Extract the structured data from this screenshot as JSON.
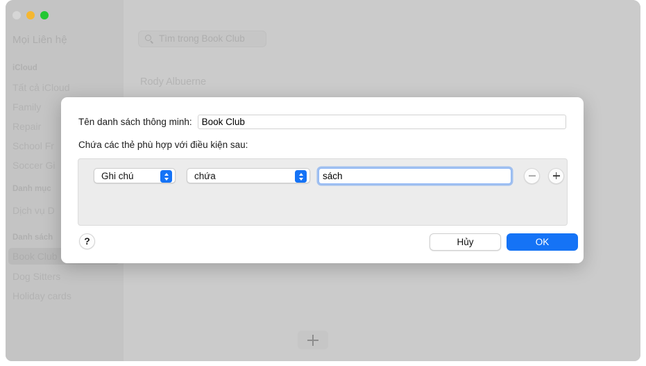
{
  "window": {
    "traffic_lights": [
      "close",
      "minimize",
      "maximize"
    ],
    "sidebar": {
      "title": "Mọi Liên hệ",
      "groups": [
        {
          "header": "iCloud",
          "items": [
            "Tất cả iCloud",
            "Family",
            "Repair",
            "School Fr",
            "Soccer Gi"
          ]
        },
        {
          "header": "Danh mục",
          "items": [
            "Dịch vụ D"
          ]
        },
        {
          "header": "Danh sách",
          "items": [
            "Book Club",
            "Dog Sitters",
            "Holiday cards"
          ]
        }
      ],
      "selected_item": "Book Club"
    },
    "list_column": {
      "search_placeholder": "Tìm trong Book Club",
      "search_icon": "search-icon",
      "contacts": [
        "Rody Albuerne"
      ]
    },
    "detail_pane": {
      "add_button_icon": "plus-icon"
    }
  },
  "dialog": {
    "name_label": "Tên danh sách thông minh:",
    "name_value": "Book Club",
    "condition_label": "Chứa các thẻ phù hợp với điều kiện sau:",
    "conditions": [
      {
        "attribute": "Ghi chú",
        "operator": "chứa",
        "value": "sách",
        "remove_icon": "minus-icon",
        "add_icon": "plus-icon"
      }
    ],
    "help_label": "?",
    "cancel_label": "Hủy",
    "ok_label": "OK",
    "accent_color": "#1573f6"
  }
}
